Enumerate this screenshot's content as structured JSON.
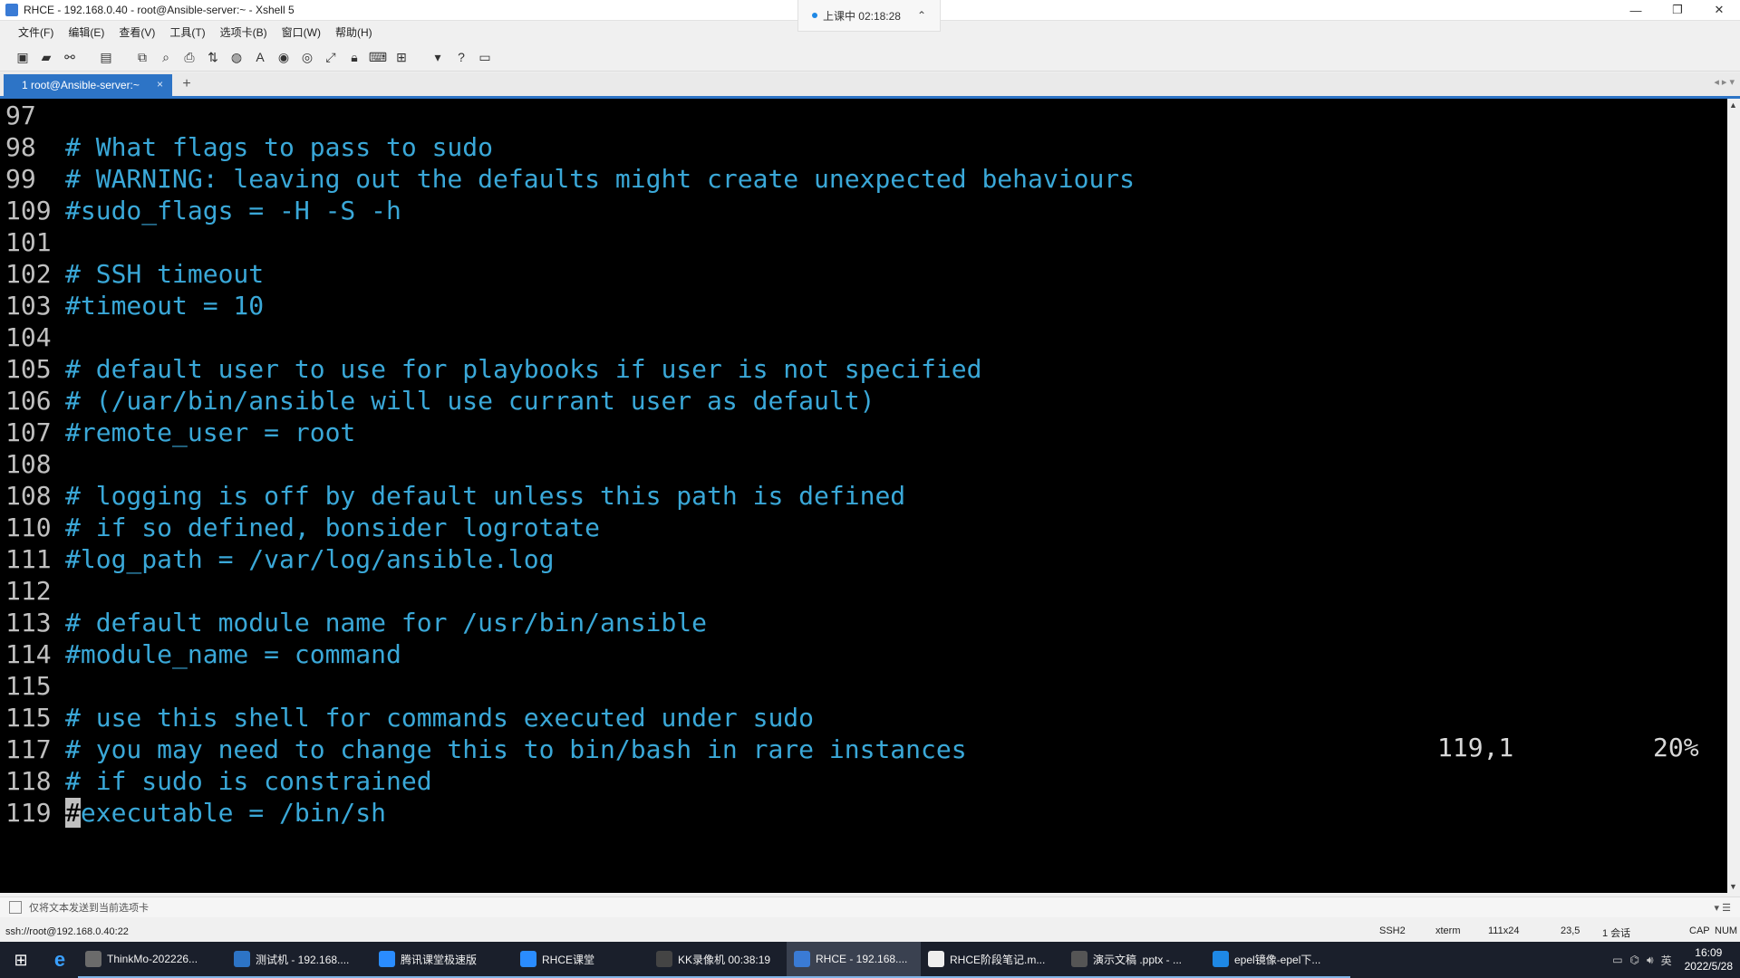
{
  "window": {
    "title": "RHCE - 192.168.0.40 - root@Ansible-server:~ - Xshell 5",
    "session_badge": "上课中 02:18:28",
    "controls": [
      "—",
      "❐",
      "✕"
    ]
  },
  "menu": [
    "文件(F)",
    "编辑(E)",
    "查看(V)",
    "工具(T)",
    "选项卡(B)",
    "窗口(W)",
    "帮助(H)"
  ],
  "toolbar_icons": [
    "new-session-icon",
    "open-folder-icon",
    "disconnect-icon",
    "properties-icon",
    "copy-icon",
    "find-icon",
    "print-icon",
    "transfer-icon",
    "globe-icon",
    "font-icon",
    "xftp-icon",
    "xmanager-icon",
    "fullscreen-icon",
    "lock-icon",
    "keyboard-icon",
    "new-tab-icon",
    "help-icon",
    "chat-icon"
  ],
  "tab": {
    "label": "1 root@Ansible-server:~",
    "close": "×",
    "add": "+"
  },
  "terminal": {
    "lines": [
      {
        "n": "97",
        "t": ""
      },
      {
        "n": "98",
        "t": "# What flags to pass to sudo"
      },
      {
        "n": "99",
        "t": "# WARNING: leaving out the defaults might create unexpected behaviours"
      },
      {
        "n": "109",
        "t": "#sudo_flags = -H -S -h"
      },
      {
        "n": "101",
        "t": ""
      },
      {
        "n": "102",
        "t": "# SSH timeout"
      },
      {
        "n": "103",
        "t": "#timeout = 10"
      },
      {
        "n": "104",
        "t": ""
      },
      {
        "n": "105",
        "t": "# default user to use for playbooks if user is not specified"
      },
      {
        "n": "106",
        "t": "# (/uar/bin/ansible will use currant user as default)"
      },
      {
        "n": "107",
        "t": "#remote_user = root"
      },
      {
        "n": "108",
        "t": ""
      },
      {
        "n": "108",
        "t": "# logging is off by default unless this path is defined"
      },
      {
        "n": "110",
        "t": "# if so defined, bonsider logrotate"
      },
      {
        "n": "111",
        "t": "#log_path = /var/log/ansible.log"
      },
      {
        "n": "112",
        "t": ""
      },
      {
        "n": "113",
        "t": "# default module name for /usr/bin/ansible"
      },
      {
        "n": "114",
        "t": "#module_name = command"
      },
      {
        "n": "115",
        "t": ""
      },
      {
        "n": "115",
        "t": "# use this shell for commands executed under sudo"
      },
      {
        "n": "117",
        "t": "# you may need to change this to bin/bash in rare instances"
      },
      {
        "n": "118",
        "t": "# if sudo is constrained"
      },
      {
        "n": "119",
        "t": "executable = /bin/sh"
      }
    ],
    "cursor_char": "#",
    "position": "119,1",
    "percent": "20%"
  },
  "compose_bar": {
    "text": "仅将文本发送到当前选项卡"
  },
  "statusbar": {
    "connection": "ssh://root@192.168.0.40:22",
    "protocol": "SSH2",
    "term": "xterm",
    "size": "111x24",
    "cursor": "23,5",
    "sessions": "1 会话",
    "cap": "CAP",
    "num": "NUM"
  },
  "taskbar": {
    "items": [
      {
        "label": "ThinkMo-202226...",
        "color": "#6b6b6b"
      },
      {
        "label": "测试机 - 192.168....",
        "color": "#2d74c6"
      },
      {
        "label": "腾讯课堂极速版",
        "color": "#2a8cff"
      },
      {
        "label": "RHCE课堂",
        "color": "#2a8cff"
      },
      {
        "label": "KK录像机 00:38:19",
        "color": "#444"
      },
      {
        "label": "RHCE - 192.168....",
        "color": "#3a7bd5"
      },
      {
        "label": "RHCE阶段笔记.m...",
        "color": "#eeeeee"
      },
      {
        "label": "演示文稿 .pptx - ...",
        "color": "#555"
      },
      {
        "label": "epel镜像-epel下...",
        "color": "#1e88e5"
      }
    ],
    "tray_lang": "英",
    "time": "16:09",
    "date": "2022/5/28"
  }
}
